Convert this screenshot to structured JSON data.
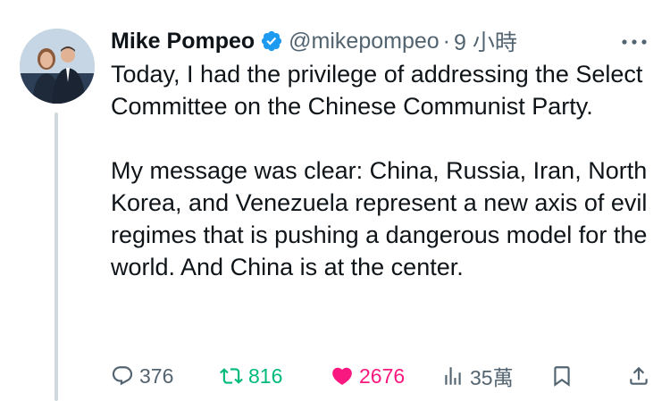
{
  "tweet": {
    "author_name": "Mike Pompeo",
    "handle": "@mikepompeo",
    "separator": "·",
    "time": "9 小時",
    "verified_icon": "verified-badge-icon",
    "paragraphs": [
      "Today, I had the privilege of addressing the Select Committee on the Chinese Communist Party.",
      "My message was clear: China, Russia, Iran, North Korea, and Venezuela represent a new axis of evil regimes that is pushing a dangerous model for the world. And China is at the center."
    ]
  },
  "actions": {
    "replies": "376",
    "retweets": "816",
    "likes": "2676",
    "views": "35萬",
    "icons": [
      "reply-icon",
      "retweet-icon",
      "like-icon",
      "views-icon",
      "bookmark-icon",
      "share-icon"
    ]
  },
  "colors": {
    "text": "#0f1419",
    "muted": "#536471",
    "verified": "#1d9bf0",
    "retweet": "#00ba7c",
    "like": "#f91880",
    "thread_line": "#cfd9de"
  }
}
